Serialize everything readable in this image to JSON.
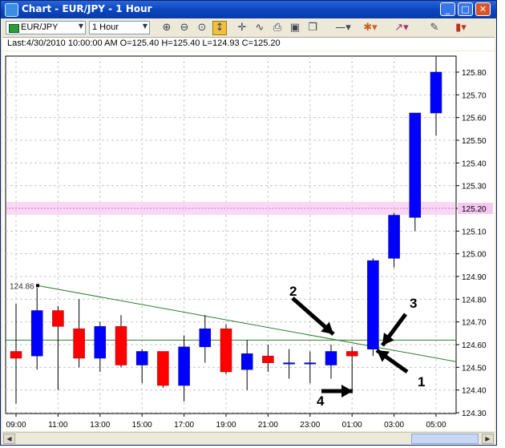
{
  "window": {
    "title": "Chart - EUR/JPY - 1 Hour",
    "min_glyph": "_",
    "max_glyph": "□",
    "close_glyph": "✕"
  },
  "toolbar": {
    "symbol": "EUR/JPY",
    "period": "1 Hour",
    "tools": [
      "zoom-in-icon",
      "zoom-out-icon",
      "zoom-fit-icon",
      "auto-scroll-icon",
      "crosshair-icon",
      "indicator-icon",
      "print-icon",
      "save-icon",
      "copy-icon",
      "line-tool-icon",
      "objects-icon",
      "properties-icon",
      "candle-style-icon"
    ]
  },
  "info": {
    "text": "Last:4/30/2010 10:00:00 AM O=125.40 H=125.40 L=124.93 C=125.20"
  },
  "colors": {
    "bull": "#0000ff",
    "bear": "#ff0000",
    "trendline": "#2e7d2e",
    "band": "#f5c8f0",
    "current_price_bg": "#f5c8f0"
  },
  "chart_data": {
    "type": "candlestick",
    "x_ticks": [
      "09:00",
      "11:00",
      "13:00",
      "15:00",
      "17:00",
      "19:00",
      "21:00",
      "23:00",
      "01:00",
      "03:00",
      "05:00"
    ],
    "ylim": [
      124.3,
      125.9
    ],
    "y_ticks": [
      "125.80",
      "125.70",
      "125.60",
      "125.50",
      "125.40",
      "125.30",
      "125.20",
      "125.10",
      "125.00",
      "124.90",
      "124.80",
      "124.70",
      "124.60",
      "124.50",
      "124.40",
      "124.30"
    ],
    "current_price": "125.20",
    "trendline_label": "124.86",
    "candles": [
      {
        "o": 124.57,
        "h": 124.78,
        "l": 124.34,
        "c": 124.54
      },
      {
        "o": 124.55,
        "h": 124.85,
        "l": 124.49,
        "c": 124.75
      },
      {
        "o": 124.75,
        "h": 124.77,
        "l": 124.4,
        "c": 124.68
      },
      {
        "o": 124.67,
        "h": 124.8,
        "l": 124.5,
        "c": 124.54
      },
      {
        "o": 124.54,
        "h": 124.7,
        "l": 124.48,
        "c": 124.68
      },
      {
        "o": 124.68,
        "h": 124.73,
        "l": 124.5,
        "c": 124.51
      },
      {
        "o": 124.51,
        "h": 124.58,
        "l": 124.43,
        "c": 124.57
      },
      {
        "o": 124.57,
        "h": 124.57,
        "l": 124.41,
        "c": 124.42
      },
      {
        "o": 124.42,
        "h": 124.64,
        "l": 124.35,
        "c": 124.59
      },
      {
        "o": 124.59,
        "h": 124.73,
        "l": 124.52,
        "c": 124.67
      },
      {
        "o": 124.67,
        "h": 124.69,
        "l": 124.47,
        "c": 124.48
      },
      {
        "o": 124.49,
        "h": 124.62,
        "l": 124.4,
        "c": 124.56
      },
      {
        "o": 124.55,
        "h": 124.6,
        "l": 124.48,
        "c": 124.52
      },
      {
        "o": 124.52,
        "h": 124.58,
        "l": 124.45,
        "c": 124.52
      },
      {
        "o": 124.52,
        "h": 124.57,
        "l": 124.43,
        "c": 124.52
      },
      {
        "o": 124.51,
        "h": 124.6,
        "l": 124.45,
        "c": 124.57
      },
      {
        "o": 124.57,
        "h": 124.59,
        "l": 124.4,
        "c": 124.55
      },
      {
        "o": 124.58,
        "h": 124.98,
        "l": 124.55,
        "c": 124.97
      },
      {
        "o": 124.98,
        "h": 125.18,
        "l": 124.94,
        "c": 125.17
      },
      {
        "o": 125.16,
        "h": 125.27,
        "l": 125.1,
        "c": 125.62
      },
      {
        "o": 125.62,
        "h": 125.87,
        "l": 125.52,
        "c": 125.8
      }
    ],
    "annotations": [
      "1",
      "2",
      "3",
      "4"
    ]
  }
}
